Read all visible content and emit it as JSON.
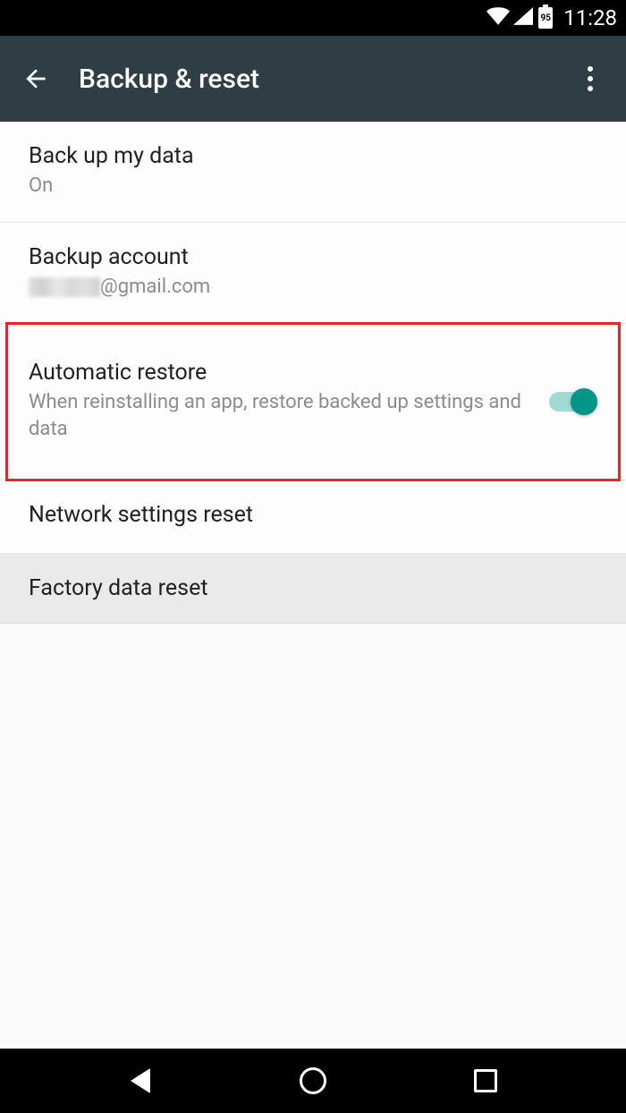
{
  "status": {
    "battery": "95",
    "time": "11:28"
  },
  "header": {
    "title": "Backup & reset"
  },
  "settings": {
    "backup_data": {
      "title": "Back up my data",
      "status": "On"
    },
    "backup_account": {
      "title": "Backup account",
      "email_suffix": "@gmail.com"
    },
    "auto_restore": {
      "title": "Automatic restore",
      "description": "When reinstalling an app, restore backed up settings and data",
      "enabled": true
    },
    "network_reset": {
      "title": "Network settings reset"
    },
    "factory_reset": {
      "title": "Factory data reset"
    }
  }
}
